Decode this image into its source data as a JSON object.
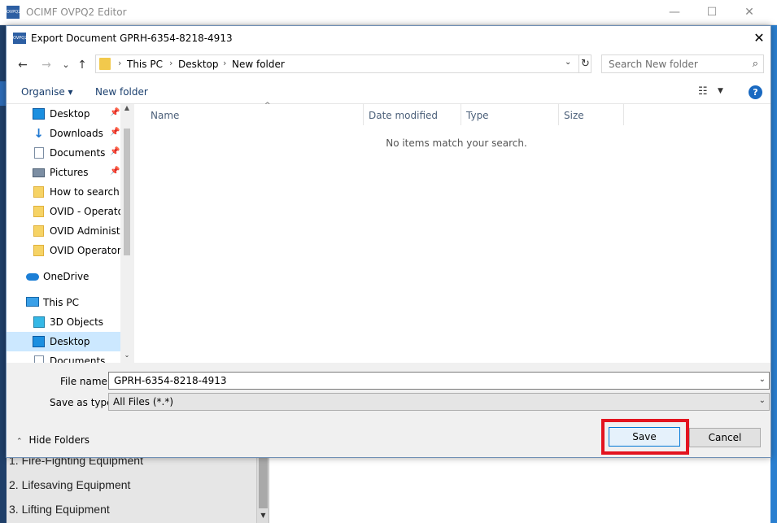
{
  "app": {
    "logo_text": "OVPQ2",
    "title": "OCIMF OVPQ2 Editor",
    "minimize_glyph": "—",
    "maximize_glyph": "☐",
    "close_glyph": "✕",
    "list_items": [
      "1. Fire-Fighting Equipment",
      "2. Lifesaving Equipment",
      "3. Lifting Equipment"
    ]
  },
  "dialog": {
    "logo_text": "OVPQ2",
    "title": "Export Document GPRH-6354-8218-4913",
    "close_glyph": "✕",
    "nav": {
      "back_glyph": "←",
      "forward_glyph": "→",
      "recent_glyph": "⌄",
      "up_glyph": "↑",
      "breadcrumb": [
        "This PC",
        "Desktop",
        "New folder"
      ],
      "sep_glyph": "›",
      "dropdown_glyph": "⌄",
      "refresh_glyph": "↻"
    },
    "search": {
      "placeholder": "Search New folder",
      "icon_glyph": "⌕"
    },
    "commands": {
      "organise": "Organise ▾",
      "new_folder": "New folder",
      "view_glyph": "☷",
      "view_dd_glyph": "▼",
      "help_glyph": "?"
    },
    "tree": [
      {
        "label": "Desktop",
        "icon": "desktop-icon",
        "pinned": true
      },
      {
        "label": "Downloads",
        "icon": "download-icon",
        "pinned": true
      },
      {
        "label": "Documents",
        "icon": "documents-icon",
        "pinned": true
      },
      {
        "label": "Pictures",
        "icon": "pictures-icon",
        "pinned": true
      },
      {
        "label": "How to search fo",
        "icon": "folder-icon",
        "pinned": false
      },
      {
        "label": "OVID - Operator",
        "icon": "folder-icon",
        "pinned": false
      },
      {
        "label": "OVID Administra",
        "icon": "folder-icon",
        "pinned": false
      },
      {
        "label": "OVID Operator -",
        "icon": "folder-icon",
        "pinned": false
      },
      {
        "label": "OneDrive",
        "icon": "onedrive-icon",
        "pinned": false
      },
      {
        "label": "This PC",
        "icon": "this-pc-icon",
        "pinned": false
      },
      {
        "label": "3D Objects",
        "icon": "3d-objects-icon",
        "pinned": false
      },
      {
        "label": "Desktop",
        "icon": "desktop-icon",
        "pinned": false,
        "selected": true
      },
      {
        "label": "Documents",
        "icon": "documents-icon",
        "pinned": false
      }
    ],
    "pin_glyph": "📌",
    "scroll_up_glyph": "▲",
    "scroll_down_glyph": "⌄",
    "columns": [
      "Name",
      "Date modified",
      "Type",
      "Size"
    ],
    "sort_glyph": "^",
    "empty_message": "No items match your search.",
    "file_name_label": "File name:",
    "file_name_value": "GPRH-6354-8218-4913",
    "save_as_type_label": "Save as type:",
    "save_as_type_value": "All Files (*.*)",
    "combo_glyph": "⌄",
    "hide_folders_glyph": "⌃",
    "hide_folders": "Hide Folders",
    "save": "Save",
    "cancel": "Cancel"
  },
  "colors": {
    "accent": "#0078d7",
    "highlight": "#e3141f",
    "selection": "#cce8ff"
  }
}
